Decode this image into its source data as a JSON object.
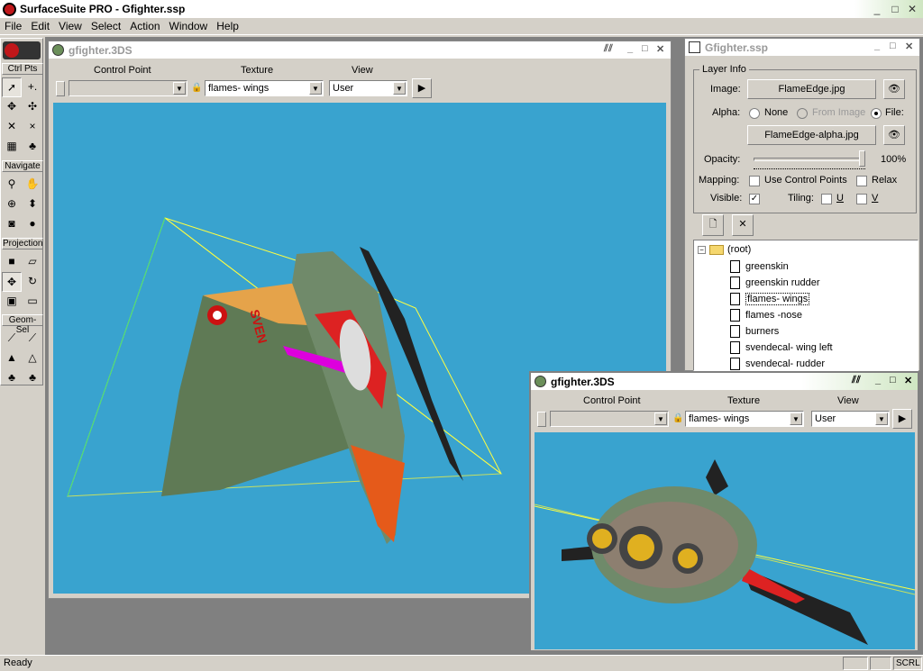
{
  "app": {
    "title": "SurfaceSuite PRO - Gfighter.ssp"
  },
  "menu": [
    "File",
    "Edit",
    "View",
    "Select",
    "Action",
    "Window",
    "Help"
  ],
  "toolbox": {
    "groups": [
      "Ctrl Pts",
      "Navigate",
      "Projection",
      "Geom-Sel"
    ]
  },
  "main_view": {
    "title": "gfighter.3DS",
    "control_point_label": "Control Point",
    "texture_label": "Texture",
    "view_label": "View",
    "texture_value": "flames- wings",
    "view_value": "User"
  },
  "panel": {
    "title": "Gfighter.ssp",
    "layer_info": "Layer Info",
    "image_label": "Image:",
    "image_value": "FlameEdge.jpg",
    "alpha_label": "Alpha:",
    "alpha_none": "None",
    "alpha_from_image": "From Image",
    "alpha_file": "File:",
    "alpha_value": "FlameEdge-alpha.jpg",
    "opacity_label": "Opacity:",
    "opacity_value": "100%",
    "opacity_fraction": 1.0,
    "mapping_label": "Mapping:",
    "use_control_points": "Use Control Points",
    "relax": "Relax",
    "visible_label": "Visible:",
    "tiling_label": "Tiling:",
    "tiling_u": "U",
    "tiling_v": "V",
    "tree": [
      "(root)",
      "greenskin",
      "greenskin rudder",
      "flames- wings",
      "flames -nose",
      "burners",
      "svendecal- wing left",
      "svendecal- rudder"
    ]
  },
  "second_view": {
    "title": "gfighter.3DS",
    "control_point_label": "Control Point",
    "texture_label": "Texture",
    "view_label": "View",
    "texture_value": "flames- wings",
    "view_value": "User"
  },
  "status": {
    "text": "Ready",
    "scrl": "SCRL"
  },
  "colors": {
    "viewport": "#39a3cf",
    "hull": "#6f8a6a",
    "flame": "#e8491e"
  }
}
